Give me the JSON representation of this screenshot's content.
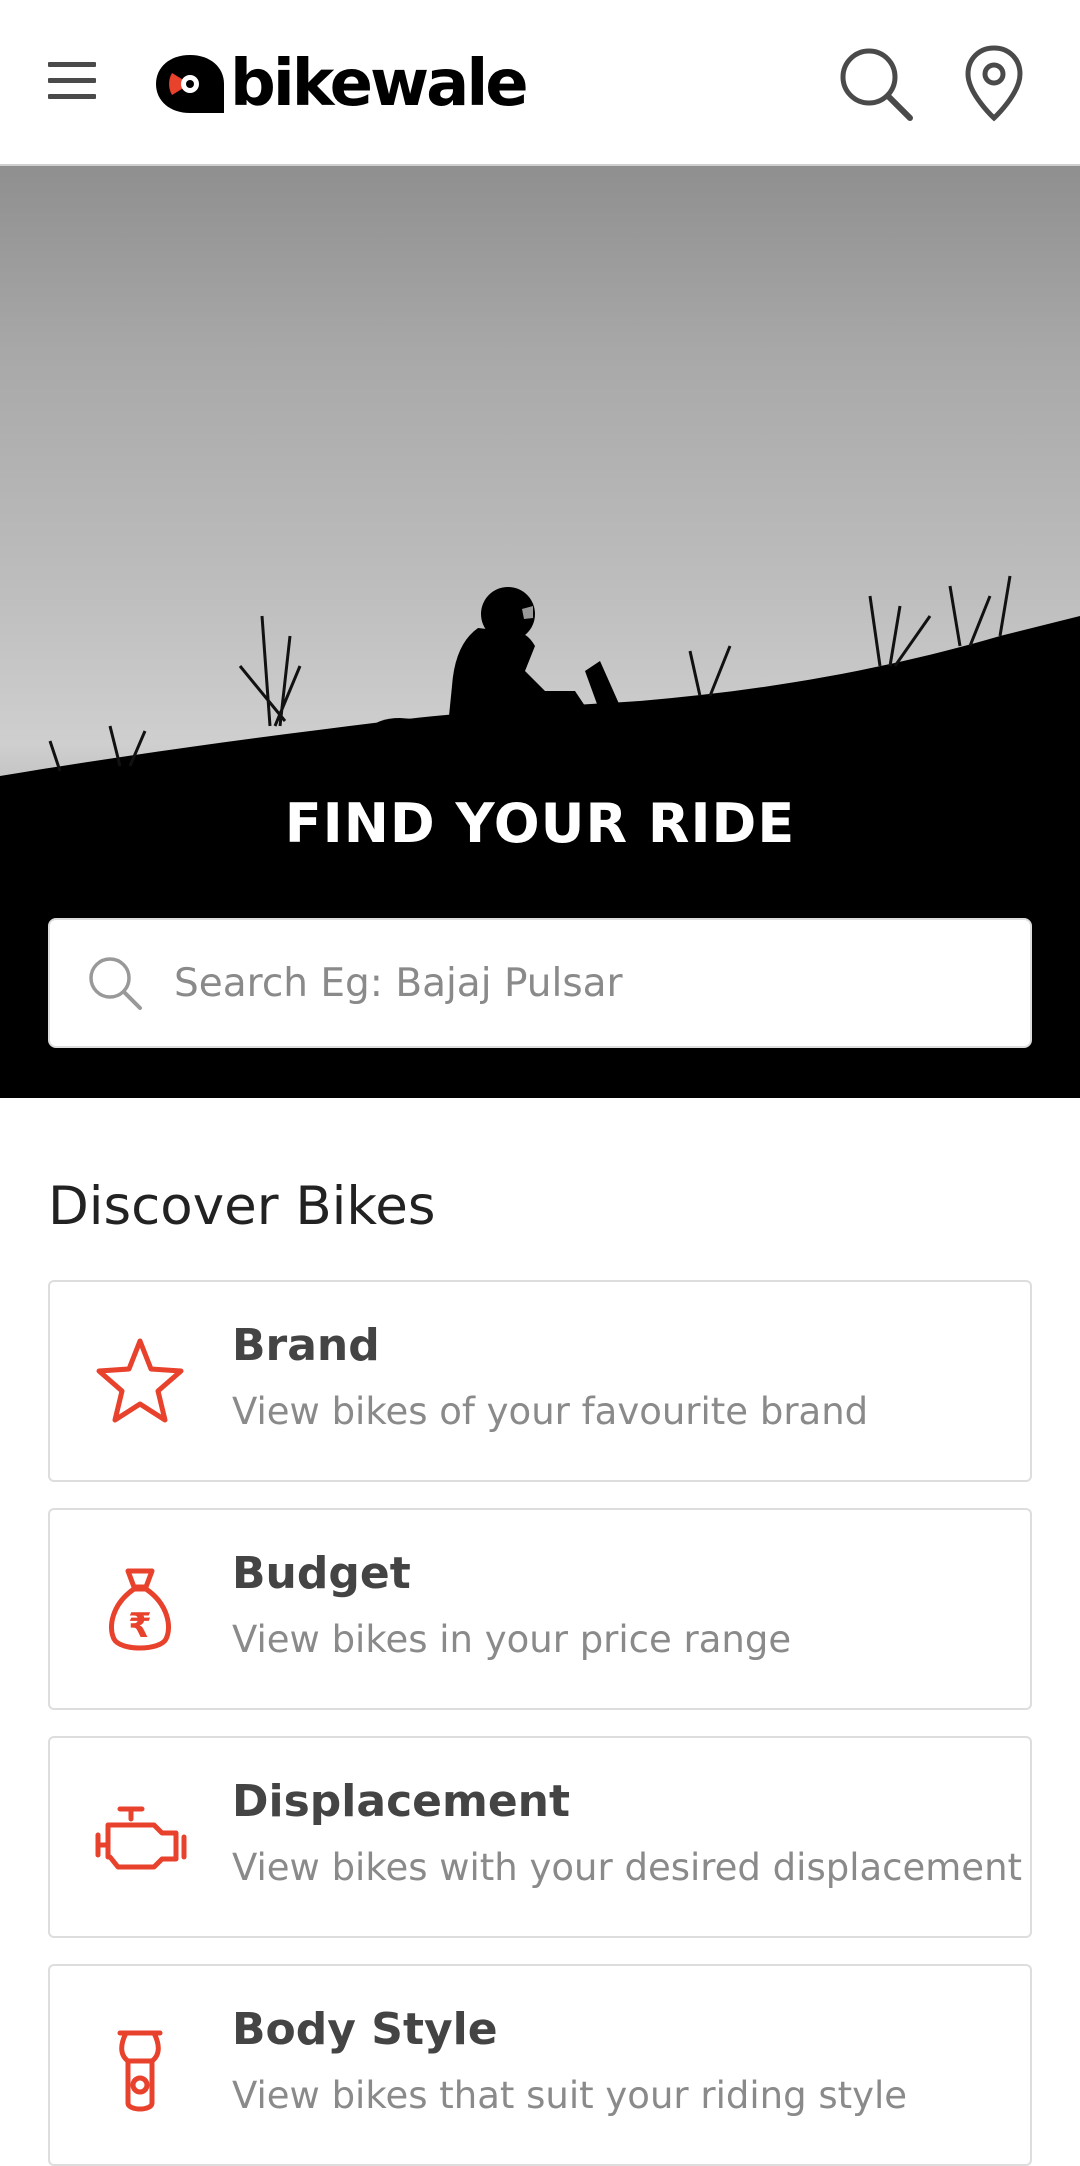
{
  "header": {
    "logo_text": "bikewale",
    "menu_icon": "hamburger-menu-icon",
    "search_icon": "search-icon",
    "location_icon": "location-pin-icon",
    "accent_color": "#e8412c"
  },
  "hero": {
    "title": "FIND YOUR RIDE",
    "search": {
      "placeholder": "Search Eg: Bajaj Pulsar",
      "icon": "search-icon"
    }
  },
  "discover": {
    "title": "Discover Bikes",
    "items": [
      {
        "label": "Brand",
        "description": "View bikes of your favourite brand",
        "icon": "star-icon"
      },
      {
        "label": "Budget",
        "description": "View bikes in your price range",
        "icon": "money-bag-rupee-icon"
      },
      {
        "label": "Displacement",
        "description": "View bikes with your desired displacement",
        "icon": "engine-icon"
      },
      {
        "label": "Body Style",
        "description": "View bikes that suit your riding style",
        "icon": "scooter-icon"
      }
    ]
  }
}
